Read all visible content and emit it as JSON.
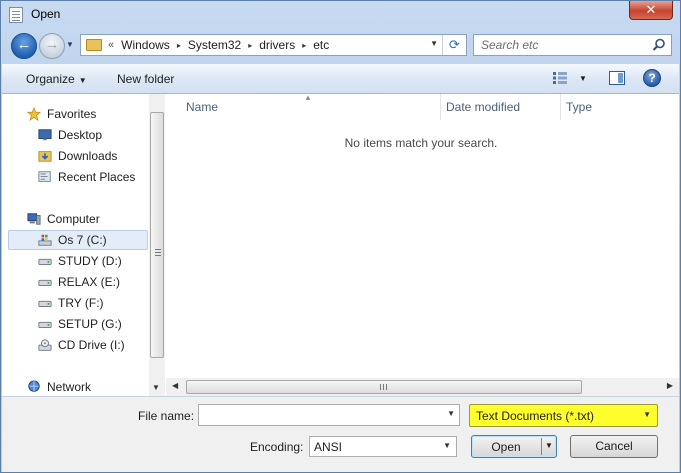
{
  "window": {
    "title": "Open",
    "close_glyph": "✕"
  },
  "nav": {
    "back_glyph": "←",
    "forward_glyph": "→",
    "history_glyph": "▼"
  },
  "address": {
    "overflow": "«",
    "crumbs": [
      "Windows",
      "System32",
      "drivers",
      "etc"
    ],
    "separator": "▸",
    "dropdown_glyph": "▼",
    "refresh_glyph": "⟳"
  },
  "search": {
    "placeholder": "Search etc"
  },
  "toolbar": {
    "organize": "Organize",
    "organize_caret": "▼",
    "new_folder": "New folder",
    "views_caret": "▼",
    "help": "?"
  },
  "sidebar": {
    "favorites_label": "Favorites",
    "favorites": [
      "Desktop",
      "Downloads",
      "Recent Places"
    ],
    "computer_label": "Computer",
    "drives": [
      "Os 7 (C:)",
      "STUDY (D:)",
      "RELAX (E:)",
      "TRY (F:)",
      "SETUP (G:)",
      "CD Drive (I:)"
    ],
    "network_label": "Network",
    "scroll_down_glyph": "▼"
  },
  "file_list": {
    "columns": [
      "Name",
      "Date modified",
      "Type"
    ],
    "sort_glyph": "▲",
    "empty_message": "No items match your search.",
    "scroll_left_glyph": "◀",
    "scroll_right_glyph": "▶"
  },
  "bottom": {
    "file_name_label": "File name:",
    "file_name_value": "",
    "file_name_dd": "▼",
    "file_type": "Text Documents (*.txt)",
    "file_type_dd": "▼",
    "encoding_label": "Encoding:",
    "encoding_value": "ANSI",
    "encoding_dd": "▼",
    "open": "Open",
    "open_dd": "▼",
    "cancel": "Cancel"
  },
  "colors": {
    "highlight": "#ffff2e",
    "close": "#c7432e",
    "accent": "#2a5da8"
  }
}
